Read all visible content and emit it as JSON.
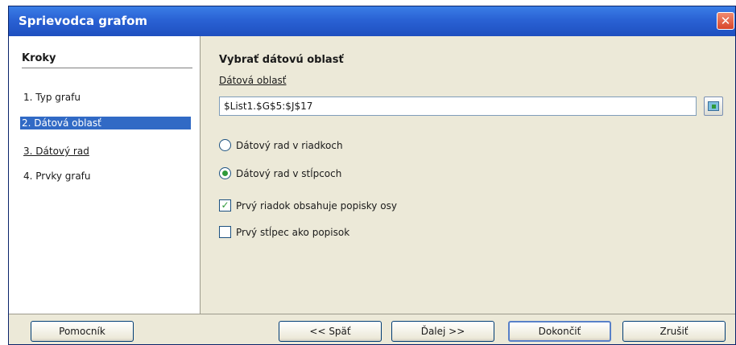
{
  "window": {
    "title": "Sprievodca grafom",
    "close_glyph": "✕"
  },
  "steps": {
    "heading": "Kroky",
    "items": [
      {
        "label": "1. Typ grafu"
      },
      {
        "label": "2. Dátová oblasť"
      },
      {
        "label": "3. Dátový rad"
      },
      {
        "label": "4. Prvky grafu"
      }
    ],
    "active_index": 1
  },
  "content": {
    "section_title": "Vybrať dátovú oblasť",
    "range_label": "Dátová oblasť",
    "range_value": "$List1.$G$5:$J$17",
    "options": {
      "rows_label": "Dátový rad v riadkoch",
      "columns_label": "Dátový rad v stĺpcoch",
      "selected": "columns"
    },
    "checks": {
      "first_row_label": "Prvý riadok obsahuje popisky osy",
      "first_row_checked": true,
      "first_col_label": "Prvý stĺpec ako popisok",
      "first_col_checked": false,
      "check_glyph": "✓"
    }
  },
  "footer": {
    "help": "Pomocník",
    "back": "<< Späť",
    "next": "Ďalej >>",
    "finish": "Dokončiť",
    "cancel": "Zrušiť"
  },
  "colors": {
    "titlebar": "#2a62d4",
    "selection": "#316ac5",
    "dialog_bg": "#ece9d8",
    "accent_green": "#2f9a3a"
  }
}
